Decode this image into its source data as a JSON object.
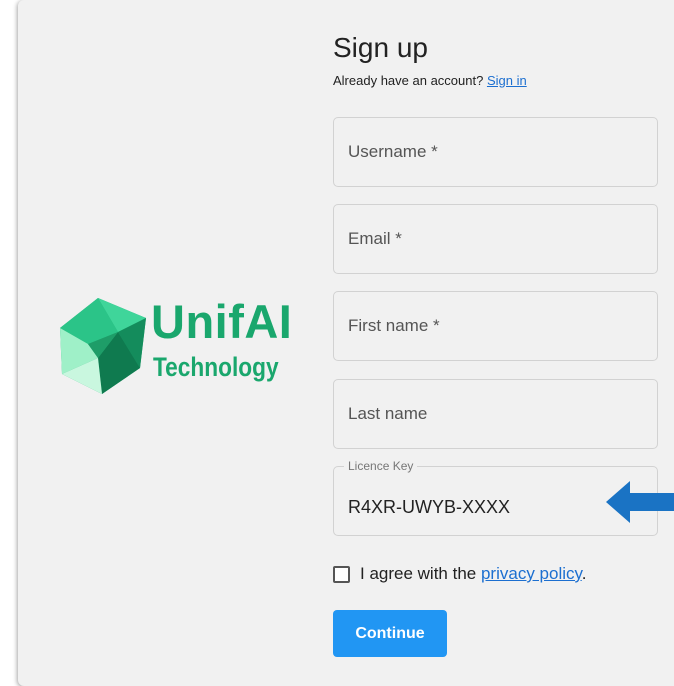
{
  "brand": {
    "name": "UnifAI",
    "subtitle": "Technology",
    "logo_icon": "polyhedron-logo-icon",
    "color": "#1aa76d"
  },
  "form": {
    "title": "Sign up",
    "signin_prompt": "Already have an account?",
    "signin_link": "Sign in",
    "fields": {
      "username": {
        "placeholder": "Username *"
      },
      "email": {
        "placeholder": "Email *"
      },
      "first_name": {
        "placeholder": "First name *"
      },
      "last_name": {
        "placeholder": "Last name"
      },
      "licence": {
        "label": "Licence Key",
        "value": "R4XR-UWYB-XXXX"
      }
    },
    "agree_prefix": "I agree with the ",
    "agree_link": "privacy policy",
    "agree_suffix": ".",
    "continue_label": "Continue"
  },
  "annotation": {
    "icon": "left-arrow-icon",
    "color": "#1a73c4"
  },
  "colors": {
    "accent": "#2196f3",
    "link": "#1c6fd0",
    "background": "#f1f1f1"
  }
}
